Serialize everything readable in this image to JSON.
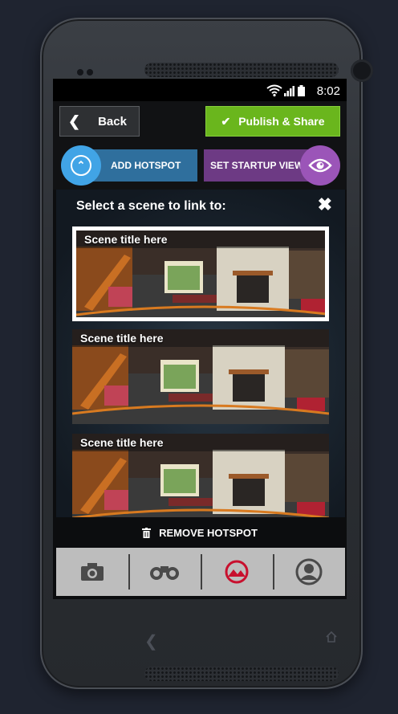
{
  "status": {
    "time": "8:02",
    "icons": [
      "wifi-icon",
      "signal-icon",
      "battery-icon"
    ]
  },
  "toolbar": {
    "back_label": "Back",
    "publish_label": "Publish & Share"
  },
  "actions": {
    "add_hotspot_label": "ADD HOTSPOT",
    "startup_view_label": "SET STARTUP VIEW"
  },
  "panel": {
    "title": "Select a scene to link to:",
    "scenes": [
      {
        "title": "Scene title here",
        "selected": true
      },
      {
        "title": "Scene title here",
        "selected": false
      },
      {
        "title": "Scene title here",
        "selected": false
      }
    ]
  },
  "remove_label": "REMOVE HOTSPOT",
  "tabs": [
    "camera-icon",
    "binoculars-icon",
    "panorama-icon",
    "profile-icon"
  ],
  "colors": {
    "publish": "#6ab61d",
    "add_hotspot": "#41a4e6",
    "startup": "#9b55b8",
    "active_tab": "#c8102e"
  }
}
